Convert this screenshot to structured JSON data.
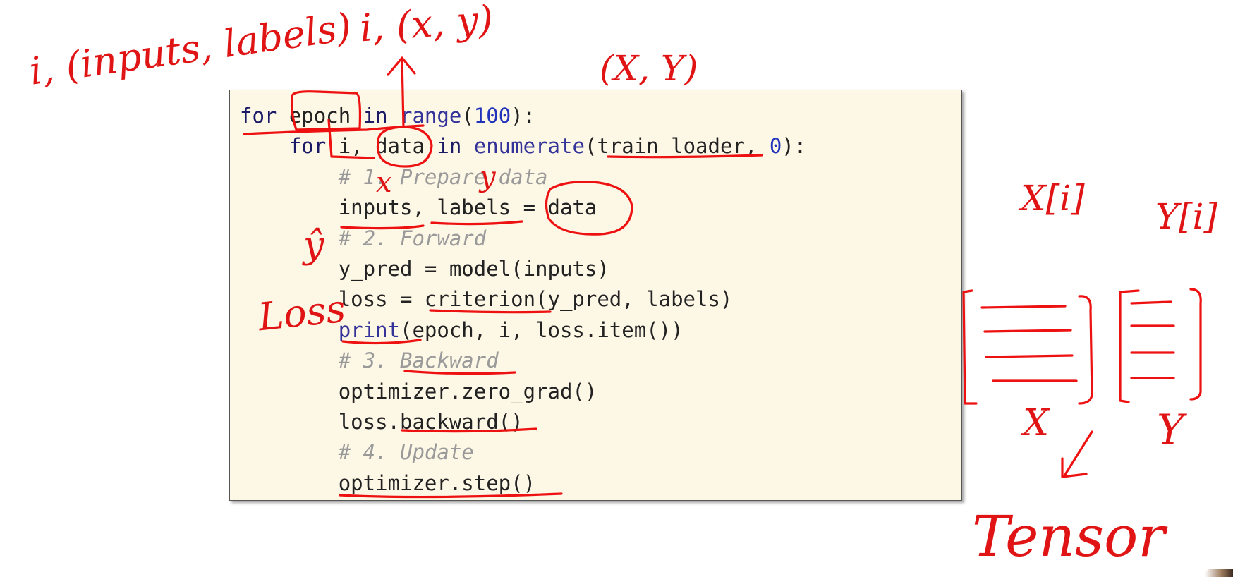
{
  "code": {
    "lines": [
      {
        "indent": "",
        "segments": [
          {
            "t": "for",
            "c": "kw"
          },
          {
            "t": " epoch "
          },
          {
            "t": "in",
            "c": "kw"
          },
          {
            "t": " "
          },
          {
            "t": "range",
            "c": "bi"
          },
          {
            "t": "("
          },
          {
            "t": "100",
            "c": "num"
          },
          {
            "t": "):"
          }
        ]
      },
      {
        "indent": "    ",
        "segments": [
          {
            "t": "for",
            "c": "kw"
          },
          {
            "t": " i, data "
          },
          {
            "t": "in",
            "c": "kw"
          },
          {
            "t": " "
          },
          {
            "t": "enumerate",
            "c": "bi"
          },
          {
            "t": "(train_loader, "
          },
          {
            "t": "0",
            "c": "num"
          },
          {
            "t": "):"
          }
        ]
      },
      {
        "indent": "        ",
        "segments": [
          {
            "t": "# 1. Prepare data",
            "c": "cm"
          }
        ]
      },
      {
        "indent": "        ",
        "segments": [
          {
            "t": "inputs, labels = data"
          }
        ]
      },
      {
        "indent": "        ",
        "segments": [
          {
            "t": "# 2. Forward",
            "c": "cm"
          }
        ]
      },
      {
        "indent": "        ",
        "segments": [
          {
            "t": "y_pred = model(inputs)"
          }
        ]
      },
      {
        "indent": "        ",
        "segments": [
          {
            "t": "loss = criterion(y_pred, labels)"
          }
        ]
      },
      {
        "indent": "        ",
        "segments": [
          {
            "t": "print",
            "c": "bi"
          },
          {
            "t": "(epoch, i, loss.item())"
          }
        ]
      },
      {
        "indent": "        ",
        "segments": [
          {
            "t": "# 3. Backward",
            "c": "cm"
          }
        ]
      },
      {
        "indent": "        ",
        "segments": [
          {
            "t": "optimizer.zero_grad()"
          }
        ]
      },
      {
        "indent": "        ",
        "segments": [
          {
            "t": "loss.backward()"
          }
        ]
      },
      {
        "indent": "        ",
        "segments": [
          {
            "t": "# 4. Update",
            "c": "cm"
          }
        ]
      },
      {
        "indent": "        ",
        "segments": [
          {
            "t": "optimizer.step()"
          }
        ]
      }
    ]
  },
  "annotations": {
    "i_inputs_labels": "i, (inputs, labels)",
    "i_x_y": "i, (x, y)",
    "x_y_top": "(X, Y)",
    "x_mark": "x",
    "y_mark": "y",
    "y_hat": "ŷ",
    "loss": "Loss",
    "x_i": "X[i]",
    "y_i": "Y[i]",
    "x_label": "X",
    "y_label": "Y",
    "tensor": "Tensor"
  },
  "colors": {
    "ink": "#e01414",
    "code_background": "#fdf7e6",
    "comment": "#9a9a9a",
    "keyword": "#1a1a66"
  }
}
